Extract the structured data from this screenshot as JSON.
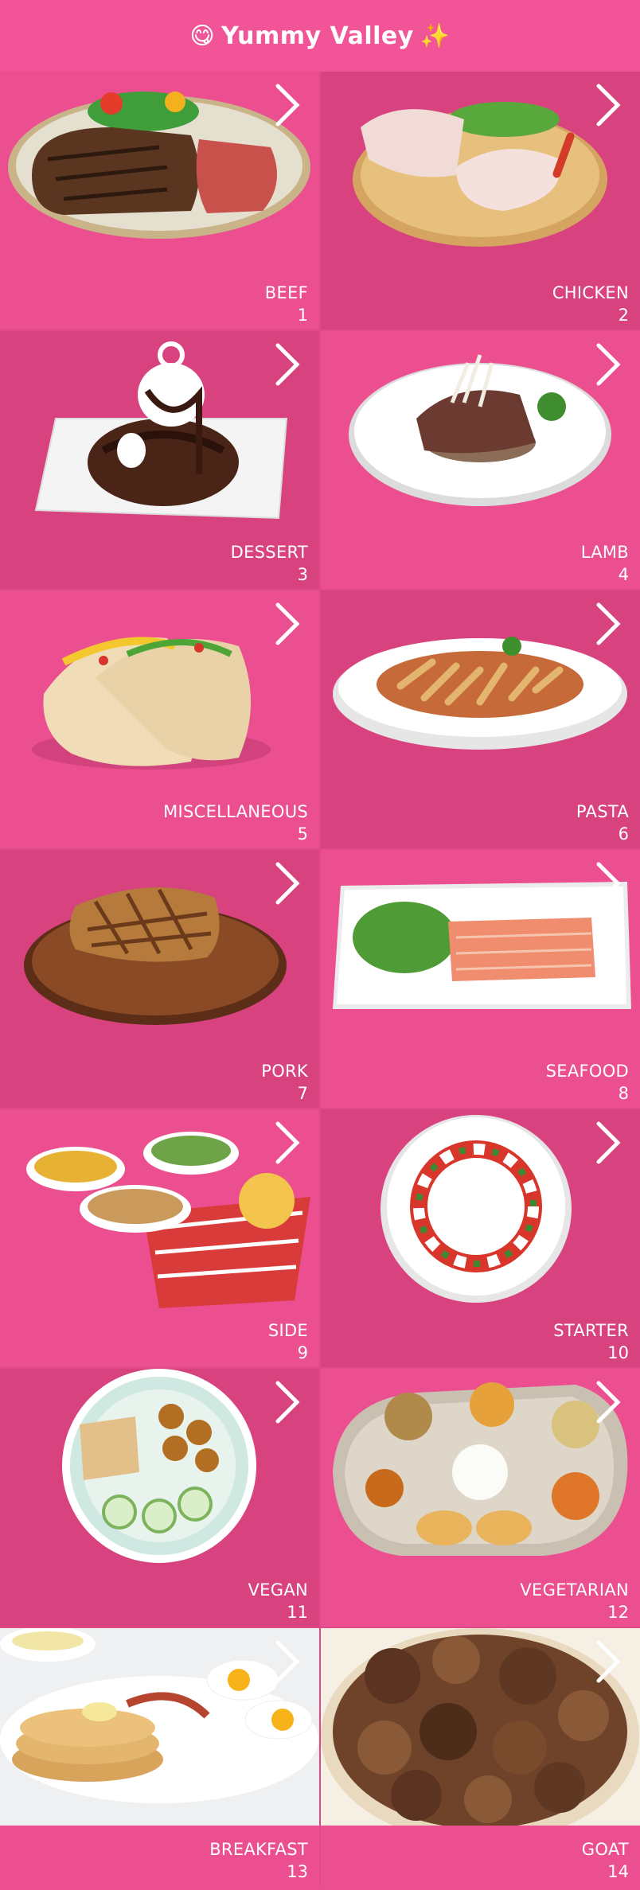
{
  "header": {
    "emoji_left": "😋",
    "title": "Yummy Valley",
    "emoji_right": "✨"
  },
  "categories": [
    {
      "label": "BEEF",
      "number": "1"
    },
    {
      "label": "CHICKEN",
      "number": "2"
    },
    {
      "label": "DESSERT",
      "number": "3"
    },
    {
      "label": "LAMB",
      "number": "4"
    },
    {
      "label": "MISCELLANEOUS",
      "number": "5"
    },
    {
      "label": "PASTA",
      "number": "6"
    },
    {
      "label": "PORK",
      "number": "7"
    },
    {
      "label": "SEAFOOD",
      "number": "8"
    },
    {
      "label": "SIDE",
      "number": "9"
    },
    {
      "label": "STARTER",
      "number": "10"
    },
    {
      "label": "VEGAN",
      "number": "11"
    },
    {
      "label": "VEGETARIAN",
      "number": "12"
    },
    {
      "label": "BREAKFAST",
      "number": "13"
    },
    {
      "label": "GOAT",
      "number": "14"
    }
  ],
  "icons": {
    "tile_arrow": "chevron-right-icon"
  },
  "colors": {
    "header": "#f15497",
    "tile_light": "#ec4f8f",
    "tile_dark": "#d8437f",
    "text": "#ffffff"
  }
}
